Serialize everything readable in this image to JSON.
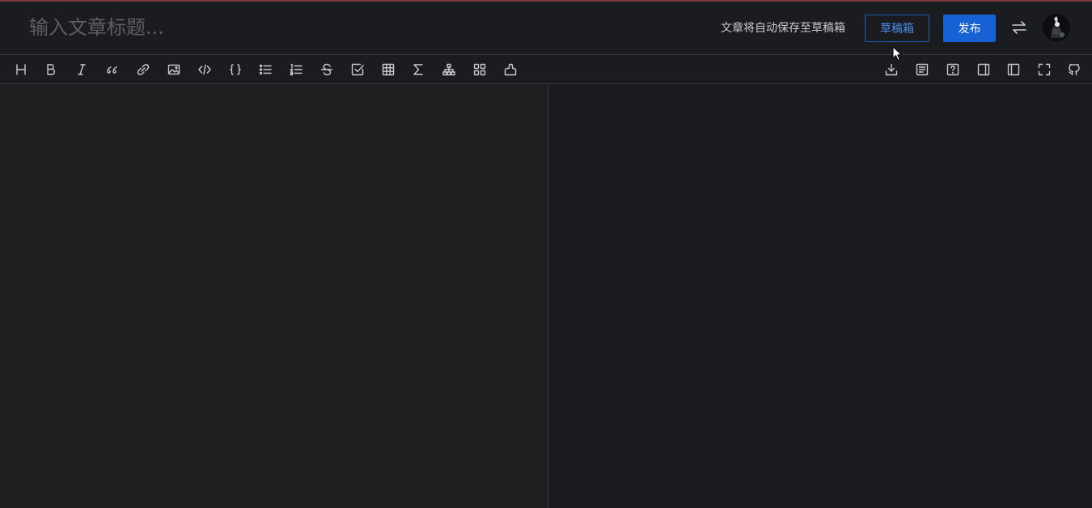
{
  "header": {
    "title_placeholder": "输入文章标题...",
    "autosave_text": "文章将自动保存至草稿箱",
    "draft_label": "草稿箱",
    "publish_label": "发布"
  },
  "icons": {
    "switch": "switch-editor-icon",
    "avatar": "user-avatar"
  },
  "toolbar_left": [
    "heading-icon",
    "bold-icon",
    "italic-icon",
    "quote-icon",
    "link-icon",
    "image-icon",
    "inline-code-icon",
    "code-block-icon",
    "unordered-list-icon",
    "ordered-list-icon",
    "strikethrough-icon",
    "task-list-icon",
    "table-icon",
    "formula-icon",
    "diagram-icon",
    "plugins-icon",
    "theme-icon"
  ],
  "toolbar_right": [
    "export-icon",
    "toc-icon",
    "help-icon",
    "preview-only-icon",
    "editor-only-icon",
    "fullscreen-icon",
    "github-icon"
  ],
  "colors": {
    "background": "#1b1c1f",
    "editor_background": "#1d1f20",
    "accent": "#1662d4",
    "draft_border": "#1e5db8",
    "draft_text": "#4b8df0",
    "top_accent": "#7a3c3c"
  }
}
